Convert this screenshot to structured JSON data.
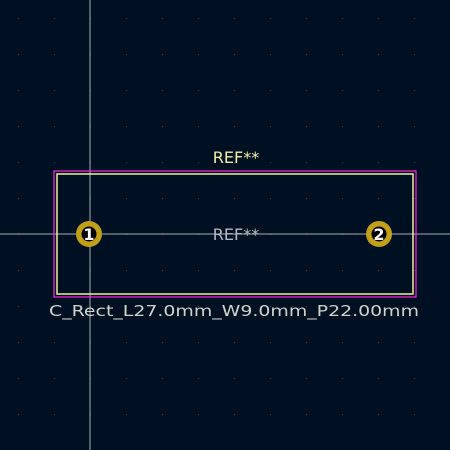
{
  "footprint": {
    "reference_top": "REF**",
    "reference_fab": "REF**",
    "value": "C_Rect_L27.0mm_W9.0mm_P22.00mm",
    "pads": [
      {
        "number": "1"
      },
      {
        "number": "2"
      }
    ]
  },
  "colors": {
    "background": "#001023",
    "grid_dot": "#3a4a5c",
    "crosshair": "#c8c8c8",
    "silkscreen_ref": "#f2eda1",
    "courtyard_outline": "#ff26e2",
    "fab_outline": "#f2eda1",
    "fab_text": "#b5b8c3",
    "value_text": "#d0d2cd",
    "pad_fill": "#c2a019",
    "pad_hole": "#000000",
    "pad_number": "#ffffff"
  }
}
